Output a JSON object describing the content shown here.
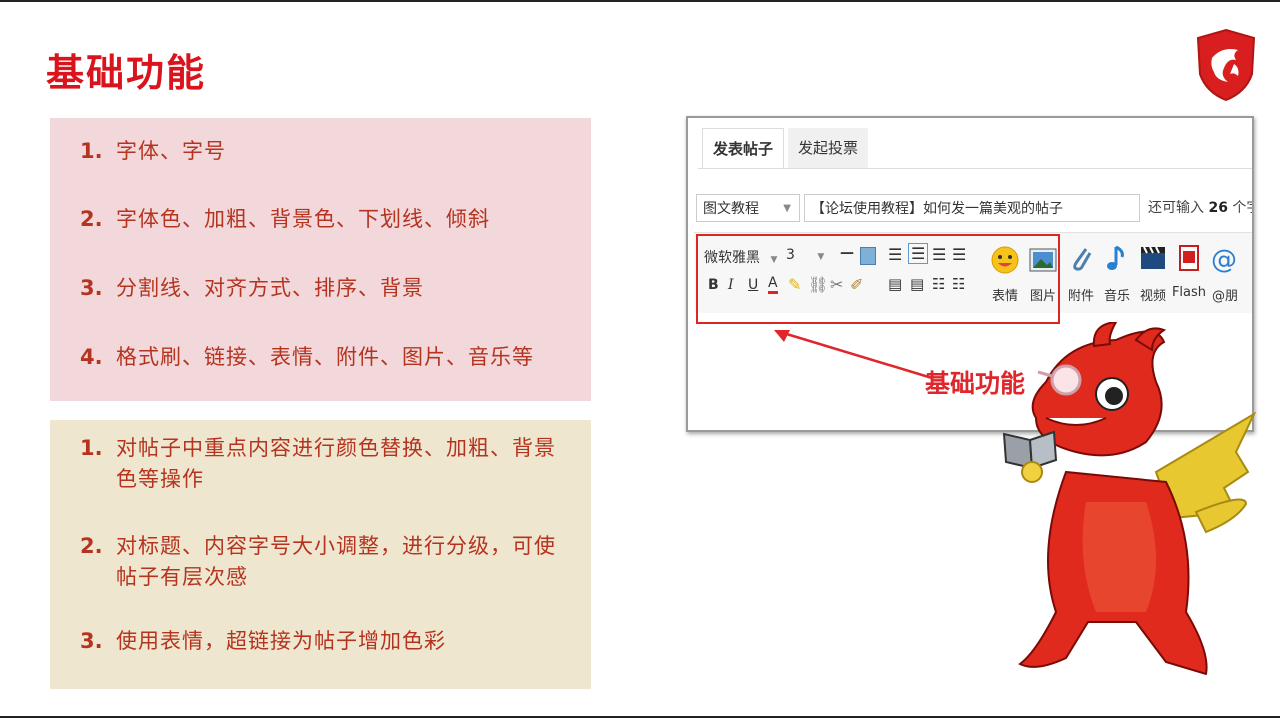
{
  "slide": {
    "title": "基础功能",
    "features": [
      {
        "num": "1.",
        "text": "字体、字号"
      },
      {
        "num": "2.",
        "text": "字体色、加粗、背景色、下划线、倾斜"
      },
      {
        "num": "3.",
        "text": "分割线、对齐方式、排序、背景"
      },
      {
        "num": "4.",
        "text": "格式刷、链接、表情、附件、图片、音乐等"
      }
    ],
    "benefits": [
      {
        "num": "1.",
        "text": "对帖子中重点内容进行颜色替换、加粗、背景色等操作"
      },
      {
        "num": "2.",
        "text": "对标题、内容字号大小调整，进行分级，可使帖子有层次感"
      },
      {
        "num": "3.",
        "text": "使用表情，超链接为帖子增加色彩"
      }
    ],
    "annotation": "基础功能"
  },
  "editor": {
    "tabs": [
      "发表帖子",
      "发起投票"
    ],
    "category": "图文教程",
    "subject": "【论坛使用教程】如何发一篇美观的帖子",
    "counter_prefix": "还可输入",
    "counter_value": "26",
    "counter_suffix": "个字",
    "font": "微软雅黑",
    "size": "3",
    "format_buttons": [
      "B",
      "I",
      "U",
      "A"
    ],
    "icon_labels": [
      "表情",
      "图片",
      "附件",
      "音乐",
      "视频",
      "Flash",
      "@朋"
    ]
  },
  "colors": {
    "title": "#d9141d",
    "item_text": "#b5341f",
    "pink_box": "#f2d7db",
    "beige_box": "#efe6cf",
    "highlight": "#e02424"
  }
}
